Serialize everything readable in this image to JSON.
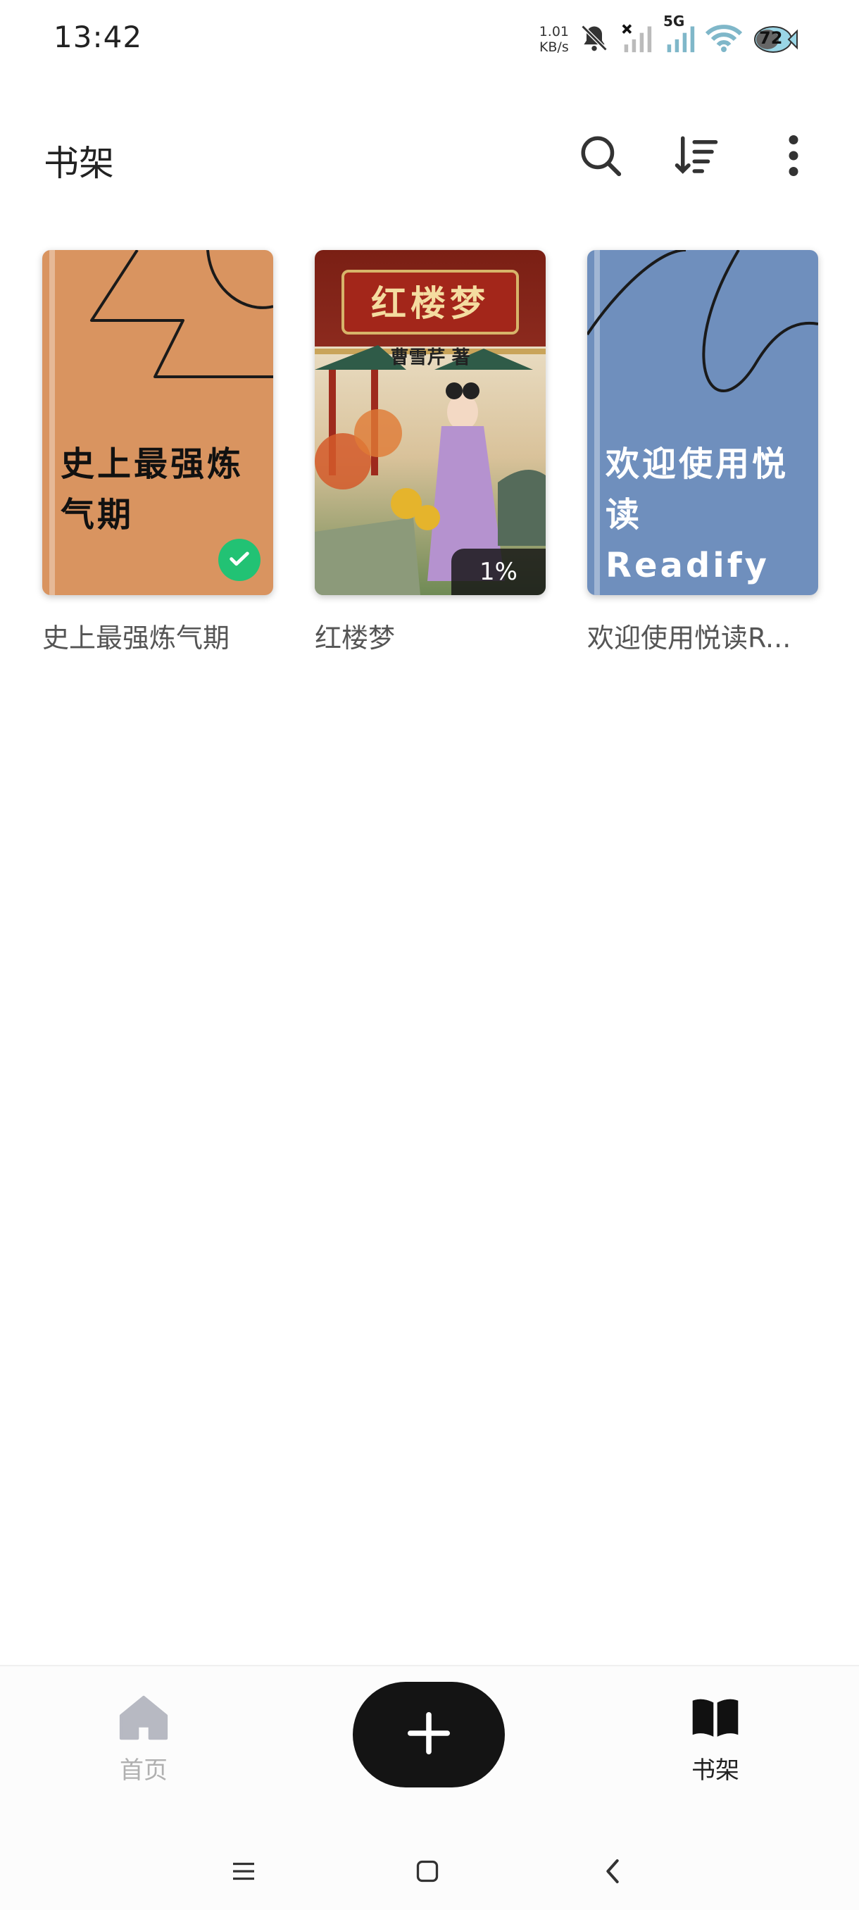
{
  "status_bar": {
    "time": "13:42",
    "net_speed_value": "1.01",
    "net_speed_unit": "KB/s",
    "network_type": "5G",
    "battery_level": "72",
    "icons": [
      "bell-off-icon",
      "signal-icon",
      "signal-5g-icon",
      "wifi-icon",
      "battery-icon"
    ]
  },
  "header": {
    "title": "书架",
    "actions": [
      "search-icon",
      "sort-icon",
      "more-vertical-icon"
    ]
  },
  "books": [
    {
      "title": "史上最强炼气期",
      "cover_text_line1": "史上最强炼",
      "cover_text_line2": "气期",
      "cover_color": "#d99460",
      "status": "selected"
    },
    {
      "title": "红楼梦",
      "cover_title": "红楼梦",
      "cover_author": "曹雪芹 著",
      "progress": "1%",
      "cover_color": "#8c2a1e"
    },
    {
      "title": "欢迎使用悦读R...",
      "cover_text_line1": "欢迎使用悦",
      "cover_text_line2": "读Readify",
      "cover_color": "#6f8fbd"
    }
  ],
  "bottom_nav": {
    "home_label": "首页",
    "add_icon": "plus-icon",
    "shelf_label": "书架",
    "active": "书架"
  },
  "colors": {
    "accent_green": "#22c274",
    "fab": "#141414"
  }
}
